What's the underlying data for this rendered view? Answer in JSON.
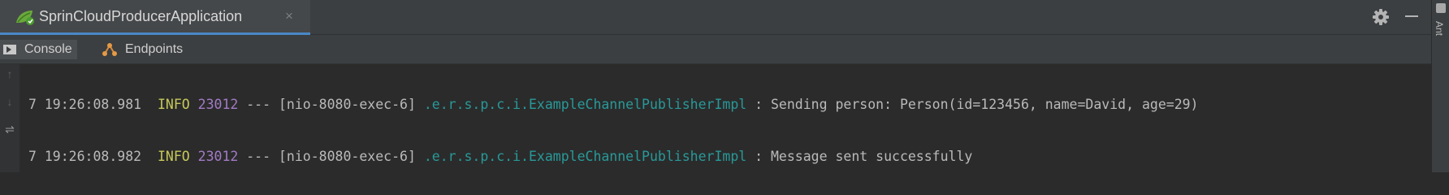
{
  "run_tab": {
    "title": "SprinCloudProducerApplication",
    "close": "×",
    "app_icon": "spring-leaf-icon"
  },
  "toolbar": {
    "settings_icon": "gear-icon",
    "hide_icon": "minimize-icon"
  },
  "subtabs": [
    {
      "label": "Console",
      "icon": "console-icon"
    },
    {
      "label": "Endpoints",
      "icon": "endpoints-icon"
    }
  ],
  "gutter": {
    "up": "↑",
    "down": "↓",
    "wrap": "⇌"
  },
  "right_panel": {
    "label": "Ant"
  },
  "log": [
    {
      "ts": "7 19:26:08.981",
      "level": "INFO",
      "pid": "23012",
      "sep": "---",
      "thread": "[nio-8080-exec-6]",
      "logger": ".e.r.s.p.c.i.ExampleChannelPublisherImpl",
      "colon": ":",
      "message": "Sending person: Person(id=123456, name=David, age=29)"
    },
    {
      "ts": "7 19:26:08.982",
      "level": "INFO",
      "pid": "23012",
      "sep": "---",
      "thread": "[nio-8080-exec-6]",
      "logger": ".e.r.s.p.c.i.ExampleChannelPublisherImpl",
      "colon": ":",
      "message": "Message sent successfully"
    }
  ],
  "colors": {
    "background": "#2b2b2b",
    "info": "#c6c85a",
    "pid": "#a37bc6",
    "logger": "#299999",
    "tab_underline": "#4a88c7"
  }
}
